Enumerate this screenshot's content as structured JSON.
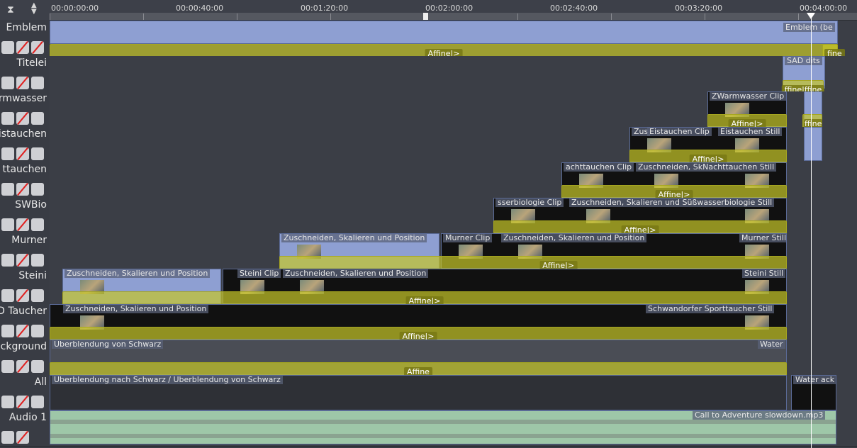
{
  "ruler": {
    "timecodes": [
      "00:00:00:00",
      "00:00:40:00",
      "00:01:20:00",
      "00:02:00:00",
      "00:02:40:00",
      "00:03:20:00",
      "00:04:00:00"
    ]
  },
  "tracks": [
    {
      "name": "Emblem"
    },
    {
      "name": "Titelei"
    },
    {
      "name": "rmwasser"
    },
    {
      "name": "istauchen"
    },
    {
      "name": "ttauchen"
    },
    {
      "name": "SWBio"
    },
    {
      "name": "Murner"
    },
    {
      "name": "Steini"
    },
    {
      "name": "D Taucher"
    },
    {
      "name": "ckground"
    },
    {
      "name": "All"
    },
    {
      "name": "Audio 1"
    }
  ],
  "clips": {
    "emblem": "Emblem (be",
    "titelei": "SAD dits",
    "warmwasser": "ZWarmwasser Clip",
    "eistauchen": "Eistauchen Clip",
    "eistauchen_still": "Eistauchen Still",
    "zus_short": "Zus",
    "nachttauchen": "achttauchen Clip",
    "nacht_still": "Zuschneiden, SkNachttauchen Still",
    "swbio": "sserbiologie Clip",
    "swbio_still": "Zuschneiden, Skalieren und Süßwasserbiologie Still",
    "zus_pos": "Zuschneiden, Skalieren und Position",
    "murner": "Murner Clip",
    "murner_still": "Murner Still",
    "steini": "Steini Clip",
    "steini_still": "Steini Still",
    "schwandorfer": "Schwandorfer Sporttaucher Still",
    "ueberblendung_von": "Überblendung von Schwarz",
    "water": "Water",
    "ueberblendung_nach": "Überblendung nach Schwarz / Überblendung von Schwarz",
    "waterback": "Water ack",
    "audio": "Call to Adventure slowdown.mp3"
  },
  "compositions": {
    "affine_arrow": "Affine|>",
    "affine": "Affine",
    "affine_short": "fine",
    "ffine": "ffine|ffine",
    "ffine_short": "ffine"
  },
  "colors": {
    "clip": "#8e9fd2",
    "composition": "#c8c828",
    "audio": "#9ec7a8",
    "background": "#393c44"
  }
}
